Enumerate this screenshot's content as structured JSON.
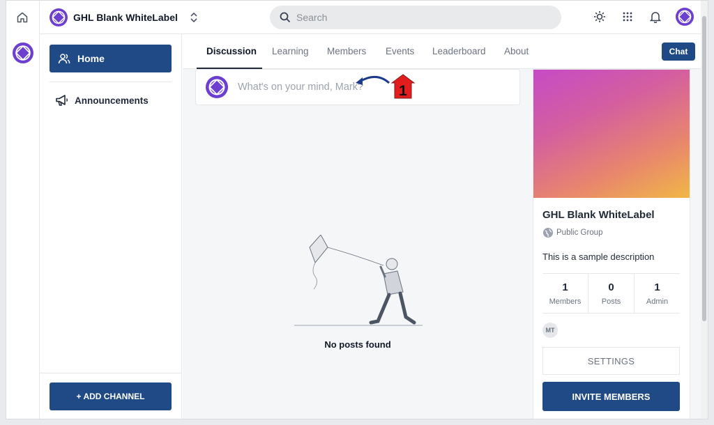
{
  "app": {
    "name": "GHL Blank WhiteLabel"
  },
  "search": {
    "placeholder": "Search"
  },
  "icons": {
    "home": "home-icon",
    "logo": "logo-icon",
    "switcher": "chevron-up-down-icon",
    "search": "search-icon",
    "theme": "sun-icon",
    "apps": "grid-icon",
    "notifications": "bell-icon",
    "profile": "avatar-icon",
    "members": "users-icon",
    "announcements": "megaphone-icon",
    "public": "globe-icon"
  },
  "sidebar": {
    "items": [
      {
        "label": "Home",
        "active": true
      },
      {
        "label": "Announcements",
        "active": false
      }
    ],
    "add_channel": "+ ADD CHANNEL"
  },
  "tabs": [
    {
      "label": "Discussion",
      "active": true
    },
    {
      "label": "Learning"
    },
    {
      "label": "Members"
    },
    {
      "label": "Events"
    },
    {
      "label": "Leaderboard"
    },
    {
      "label": "About"
    }
  ],
  "chat_label": "Chat",
  "composer": {
    "placeholder": "What's on your mind, Mark?"
  },
  "annotation": {
    "step": "1"
  },
  "empty_state": {
    "text": "No posts found"
  },
  "group": {
    "title": "GHL Blank WhiteLabel",
    "type": "Public Group",
    "description": "This is a sample description",
    "stats": [
      {
        "value": "1",
        "label": "Members"
      },
      {
        "value": "0",
        "label": "Posts"
      },
      {
        "value": "1",
        "label": "Admin"
      }
    ],
    "member_initials": "MT",
    "settings_label": "SETTINGS",
    "invite_label": "INVITE MEMBERS"
  },
  "colors": {
    "primary": "#1f4a86",
    "logo": "#6d3fd0",
    "annotation": "#e11d1d"
  }
}
